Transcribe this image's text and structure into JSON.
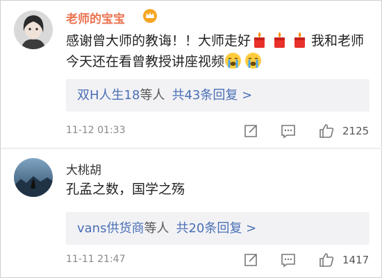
{
  "comments": [
    {
      "username": "老师的宝宝",
      "text_parts": [
        "感谢曾大师的教诲！！大师走好",
        "我和老师今天还在看曾教授讲座视频"
      ],
      "replies": {
        "users": "双H人生18",
        "mid": "等人",
        "count": "共43条回复 >"
      },
      "time": "11-12 01:33",
      "likes": "2125",
      "icons": [
        "crown-icon",
        "candle-icon",
        "candle-icon",
        "candle-icon",
        "crying-emoji-icon",
        "crying-emoji-icon",
        "share-icon",
        "comment-icon",
        "thumbs-up-icon"
      ]
    },
    {
      "username": "大桃胡",
      "text": "孔孟之数，国学之殇",
      "replies": {
        "users": "vans供货商",
        "mid": "等人",
        "count": "共20条回复 >"
      },
      "time": "11-11 21:47",
      "likes": "1417",
      "icons": [
        "share-icon",
        "comment-icon",
        "thumbs-up-icon"
      ]
    }
  ],
  "colors": {
    "vip_name": "#eb7350",
    "link": "#4a6fb5",
    "reply_bg": "#f2f2f5",
    "meta": "#888888"
  }
}
